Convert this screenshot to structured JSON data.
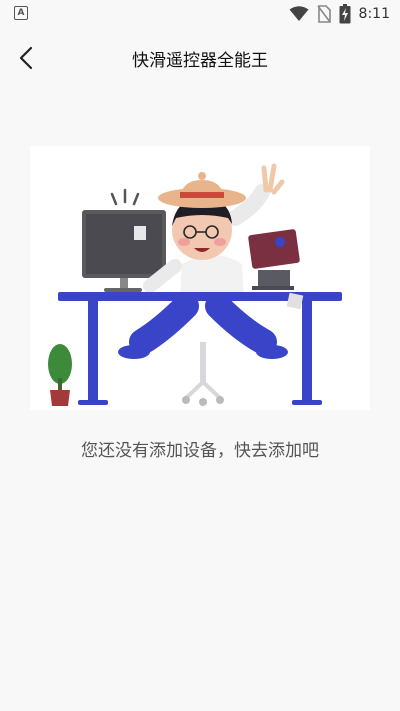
{
  "status_bar": {
    "notification_label": "A",
    "time": "8:11",
    "icons": [
      "wifi-icon",
      "no-sim-icon",
      "battery-charging-icon"
    ]
  },
  "header": {
    "title": "快滑遥控器全能王",
    "back_icon": "chevron-left-icon"
  },
  "empty_state": {
    "illustration": "person-at-desk-illustration",
    "message": "您还没有添加设备，快去添加吧"
  },
  "colors": {
    "background": "#f8f8f8",
    "desk": "#3a44c8",
    "monitor": "#5a5a5e",
    "hat": "#e8b48c",
    "laptop": "#7a3040",
    "plant": "#3d8a3a",
    "pot": "#a33a3a"
  }
}
